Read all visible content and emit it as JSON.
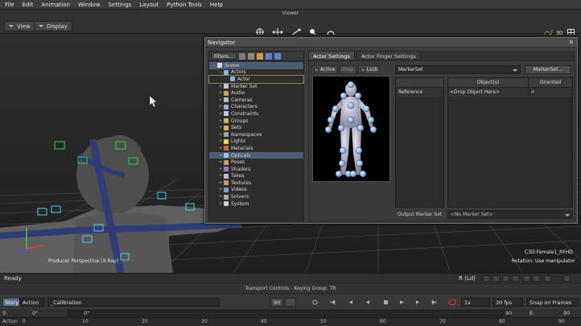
{
  "menu": [
    "File",
    "Edit",
    "Animation",
    "Window",
    "Settings",
    "Layout",
    "Python Tools",
    "Help"
  ],
  "viewer": {
    "title": "Viewer",
    "view_label": "View",
    "display_label": "Display",
    "camera_label": "Producer Perspective (X-Ray)",
    "info_line1": "C3D:Female1_RFHD",
    "info_line2": "Rotation: Use manipulator",
    "icons": [
      "select-icon",
      "translate-icon",
      "rotate-icon",
      "scale-icon",
      "undo-icon"
    ]
  },
  "navigator": {
    "title": "Navigator",
    "filters_label": "Filters...",
    "tree": [
      {
        "label": "Scene",
        "exp": "−",
        "indent": 0,
        "icon": "#d9d9d9",
        "selected": true
      },
      {
        "label": "Actors",
        "exp": "−",
        "indent": 1,
        "icon": "#7fb2e5"
      },
      {
        "label": "Actor",
        "exp": "",
        "indent": 2,
        "icon": "#7fb2e5",
        "boxed": true
      },
      {
        "label": "Marker Set",
        "exp": "+",
        "indent": 1,
        "icon": "#c9c9c9"
      },
      {
        "label": "Audio",
        "exp": "+",
        "indent": 1,
        "icon": "#c9a24a"
      },
      {
        "label": "Cameras",
        "exp": "+",
        "indent": 1,
        "icon": "#bdbdbd"
      },
      {
        "label": "Characters",
        "exp": "+",
        "indent": 1,
        "icon": "#8fb0d6"
      },
      {
        "label": "Constraints",
        "exp": "+",
        "indent": 1,
        "icon": "#c7c7c7"
      },
      {
        "label": "Groups",
        "exp": "+",
        "indent": 1,
        "icon": "#d9b44a"
      },
      {
        "label": "Sets",
        "exp": "+",
        "indent": 1,
        "icon": "#d9b44a"
      },
      {
        "label": "Namespaces",
        "exp": "+",
        "indent": 1,
        "icon": "#a0a0a0"
      },
      {
        "label": "Lights",
        "exp": "+",
        "indent": 1,
        "icon": "#e3d25b"
      },
      {
        "label": "Materials",
        "exp": "+",
        "indent": 1,
        "icon": "#c56a3a"
      },
      {
        "label": "Opticals",
        "exp": "+",
        "indent": 1,
        "icon": "#9ac0e6",
        "selected": true
      },
      {
        "label": "Poses",
        "exp": "+",
        "indent": 1,
        "icon": "#d0a04a"
      },
      {
        "label": "Shaders",
        "exp": "+",
        "indent": 1,
        "icon": "#9a7ad0"
      },
      {
        "label": "Takes",
        "exp": "+",
        "indent": 1,
        "icon": "#bdbdbd"
      },
      {
        "label": "Textures",
        "exp": "+",
        "indent": 1,
        "icon": "#c99a5a"
      },
      {
        "label": "Videos",
        "exp": "+",
        "indent": 1,
        "icon": "#7a9ad0"
      },
      {
        "label": "Solvers",
        "exp": "+",
        "indent": 1,
        "icon": "#aaaaaa"
      },
      {
        "label": "System",
        "exp": "+",
        "indent": 1,
        "icon": "#cfcfcf"
      }
    ],
    "tabs": [
      "Actor Settings",
      "Actor Finger Settings"
    ],
    "active_label": "Active",
    "snap_label": "Snap",
    "lock_label": "Lock",
    "markerset_combo": "MarkerSet",
    "markerset_button": "MarkerSet...",
    "grid_cols": [
      "Object(s)",
      "Oriented"
    ],
    "reference_label": "Reference",
    "drop_object": "<Drop Object Here>",
    "output_label": "Output Marker Set :",
    "output_value": "<No Marker Set>"
  },
  "status": {
    "left": "Ready",
    "right": "R (Ld)"
  },
  "transport": {
    "title": "Transport Controls  -  Keying Group: TR",
    "story": "Story",
    "action": "Action",
    "calibration": "_Calibration",
    "frame": "90",
    "speed": "1x",
    "fps": "30 fps",
    "snap": "Snap on Frames",
    "s_label": "S:",
    "s_value": "0\"",
    "start_value": "0\"",
    "end_value": "90",
    "e_label": "E:",
    "e_value": "90",
    "timeline_label": "Action",
    "ticks": [
      "0",
      "10",
      "20",
      "30",
      "40",
      "50",
      "60",
      "70",
      "80",
      "90"
    ]
  },
  "colors": {
    "selection": "#4e5d72",
    "story_btn": "#5b6f8e",
    "marker_blue": "#8fb8e6",
    "bone_blue": "#2f3c78",
    "cube_green": "#2fd24a",
    "cube_cyan": "#4ad0e6"
  }
}
